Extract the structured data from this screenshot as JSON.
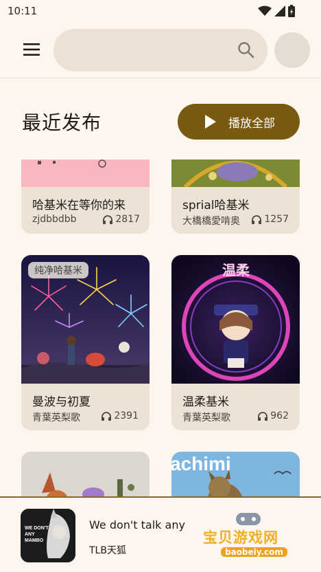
{
  "status": {
    "time": "10:11"
  },
  "section": {
    "title": "最近发布",
    "play_all_label": "播放全部"
  },
  "cards": [
    {
      "title": "哈基米在等你的来",
      "author": "zjdbbdbb",
      "plays": "2817"
    },
    {
      "title": "sprial哈基米",
      "author": "大橋橋愛啃奥",
      "plays": "1257"
    },
    {
      "title": "曼波与初夏",
      "author": "青葉英梨歌",
      "plays": "2391",
      "tag": "纯净哈基米"
    },
    {
      "title": "温柔基米",
      "author": "青葉英梨歌",
      "plays": "962",
      "art_text": "温柔"
    },
    {
      "title": "",
      "author": "",
      "plays": ""
    },
    {
      "title": "",
      "author": "",
      "plays": "",
      "art_text": "achimi"
    }
  ],
  "player": {
    "title": "We don't talk any",
    "artist": "TLB天狐",
    "art_text": "WE DON'T ANY MAMBO"
  },
  "watermark": {
    "text": "宝贝游戏网",
    "url": "baobeiy.com"
  },
  "colors": {
    "accent": "#7a5a10",
    "background": "#fdf6ee",
    "card": "#ece3d6"
  }
}
